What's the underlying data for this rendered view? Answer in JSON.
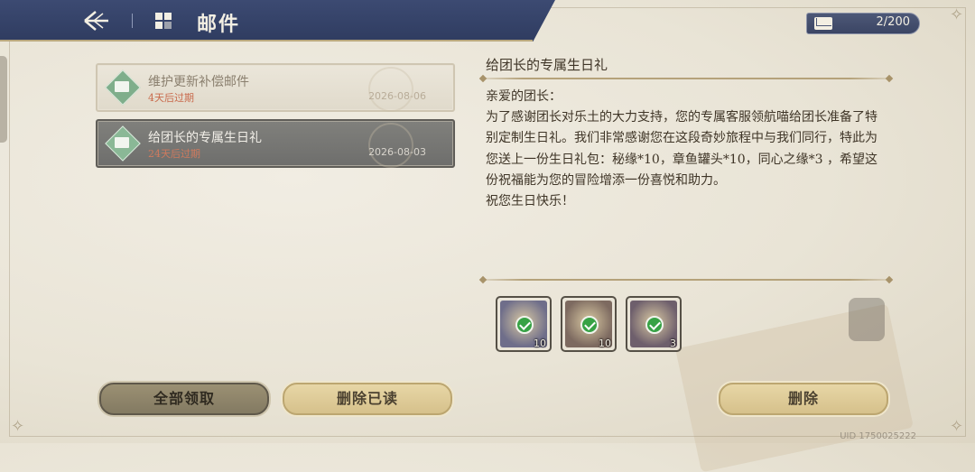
{
  "header": {
    "title": "邮件",
    "mail_count": "2/200"
  },
  "mail_list": [
    {
      "title": "维护更新补偿邮件",
      "expire": "4天后过期",
      "date": "2026-08-06",
      "state": "read"
    },
    {
      "title": "给团长的专属生日礼",
      "expire": "24天后过期",
      "date": "2026-08-03",
      "state": "selected"
    }
  ],
  "detail": {
    "title": "给团长的专属生日礼",
    "greeting": "亲爱的团长：",
    "body": "为了感谢团长对乐土的大力支持，您的专属客服领航喵给团长准备了特别定制生日礼。我们非常感谢您在这段奇妙旅程中与我们同行，特此为您送上一份生日礼包：秘缘*10，章鱼罐头*10，同心之缘*3 ，希望这份祝福能为您的冒险增添一份喜悦和助力。",
    "closing": "祝您生日快乐！"
  },
  "rewards": [
    {
      "count": "10",
      "claimed": true,
      "color": "#6f6e8a"
    },
    {
      "count": "10",
      "claimed": true,
      "color": "#7d6a60"
    },
    {
      "count": "3",
      "claimed": true,
      "color": "#6e5f6c"
    }
  ],
  "buttons": {
    "claim_all": "全部领取",
    "delete_read": "删除已读",
    "delete": "删除"
  },
  "footer": {
    "uid": "UID 1750025222"
  },
  "colors": {
    "header_bg": "#2f3c60",
    "accent_gold": "#d6c18b",
    "expire_red": "#c96a4c",
    "check_green": "#37a245"
  }
}
